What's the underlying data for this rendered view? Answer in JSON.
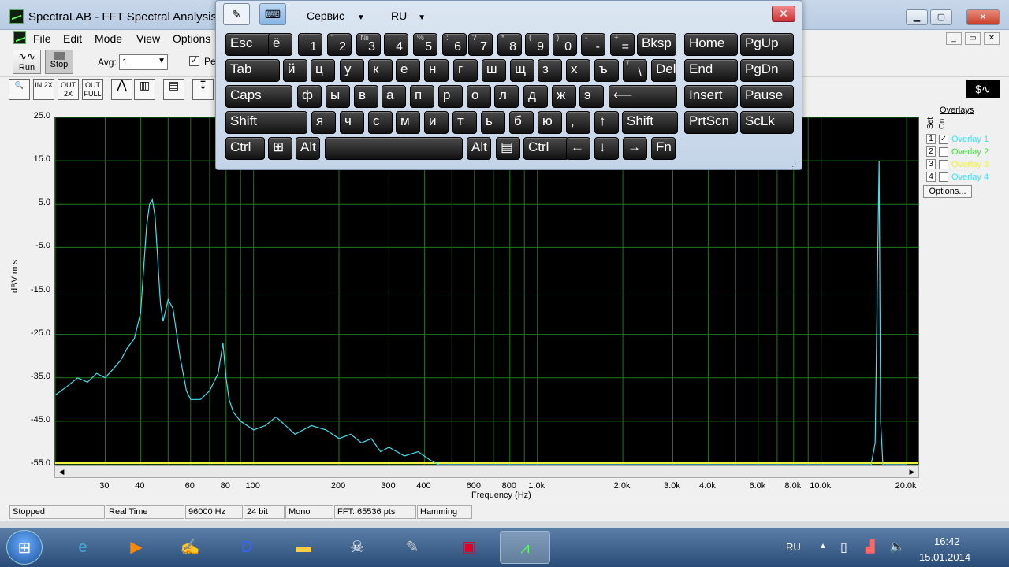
{
  "window": {
    "title": "SpectraLAB - FFT Spectral Analysis S"
  },
  "menu": [
    "File",
    "Edit",
    "Mode",
    "View",
    "Options"
  ],
  "toolbar": {
    "run_label": "Run",
    "stop_label": "Stop",
    "avg_label": "Avg:",
    "avg_value": "1",
    "pe_label": "Pe"
  },
  "toolbar2_icons": [
    "zoom-icon",
    "zoom-in-2x-icon",
    "zoom-out-2x-icon",
    "zoom-out-full-icon",
    "line-plot-icon",
    "bar-plot-icon",
    "table-icon",
    "cursor-icon"
  ],
  "toolbar2_labels": [
    "",
    "IN 2X",
    "OUT 2X",
    "OUT FULL",
    "",
    "",
    "",
    ""
  ],
  "osk": {
    "menu_service": "Сервис",
    "menu_lang": "RU",
    "rows": [
      [
        [
          "",
          "Esc"
        ],
        [
          "",
          "ё"
        ],
        [
          "!",
          "1"
        ],
        [
          "\"",
          "2"
        ],
        [
          "№",
          "3"
        ],
        [
          ";",
          "4"
        ],
        [
          "%",
          "5"
        ],
        [
          ":",
          "6"
        ],
        [
          "?",
          "7"
        ],
        [
          "*",
          "8"
        ],
        [
          "(",
          "9"
        ],
        [
          ")",
          "0"
        ],
        [
          "-",
          "-"
        ],
        [
          "+",
          "="
        ],
        [
          "",
          "Bksp"
        ],
        [
          "",
          "Home"
        ],
        [
          "",
          "PgUp"
        ]
      ],
      [
        [
          "",
          "Tab"
        ],
        [
          "",
          "й"
        ],
        [
          "",
          "ц"
        ],
        [
          "",
          "у"
        ],
        [
          "",
          "к"
        ],
        [
          "",
          "е"
        ],
        [
          "",
          "н"
        ],
        [
          "",
          "г"
        ],
        [
          "",
          "ш"
        ],
        [
          "",
          "щ"
        ],
        [
          "",
          "з"
        ],
        [
          "",
          "х"
        ],
        [
          "",
          "ъ"
        ],
        [
          "/",
          "\\"
        ],
        [
          "",
          "Del"
        ],
        [
          "",
          "End"
        ],
        [
          "",
          "PgDn"
        ]
      ],
      [
        [
          "",
          "Caps"
        ],
        [
          "",
          "ф"
        ],
        [
          "",
          "ы"
        ],
        [
          "",
          "в"
        ],
        [
          "",
          "а"
        ],
        [
          "",
          "п"
        ],
        [
          "",
          "р"
        ],
        [
          "",
          "о"
        ],
        [
          "",
          "л"
        ],
        [
          "",
          "д"
        ],
        [
          "",
          "ж"
        ],
        [
          "",
          "э"
        ],
        [
          "",
          "⟵"
        ],
        [
          "",
          "Insert"
        ],
        [
          "",
          "Pause"
        ]
      ],
      [
        [
          "",
          "Shift"
        ],
        [
          "",
          "я"
        ],
        [
          "",
          "ч"
        ],
        [
          "",
          "с"
        ],
        [
          "",
          "м"
        ],
        [
          "",
          "и"
        ],
        [
          "",
          "т"
        ],
        [
          "",
          "ь"
        ],
        [
          "",
          "б"
        ],
        [
          "",
          "ю"
        ],
        [
          "",
          ","
        ],
        [
          "",
          "↑"
        ],
        [
          "",
          "Shift"
        ],
        [
          "",
          "PrtScn"
        ],
        [
          "",
          "ScLk"
        ]
      ],
      [
        [
          "",
          "Ctrl"
        ],
        [
          "",
          "⊞"
        ],
        [
          "",
          "Alt"
        ],
        [
          "",
          ""
        ],
        [
          "",
          "Alt"
        ],
        [
          "",
          "▤"
        ],
        [
          "",
          "Ctrl"
        ],
        [
          "",
          "←"
        ],
        [
          "",
          "↓"
        ],
        [
          "",
          "→"
        ],
        [
          "",
          "Fn"
        ]
      ]
    ]
  },
  "chart_data": {
    "type": "line",
    "ylabel": "dBV rms",
    "xlabel": "Frequency (Hz)",
    "xscale": "log",
    "xlim": [
      20,
      22000
    ],
    "ylim": [
      -55,
      25
    ],
    "yticks": [
      "25.0",
      "15.0",
      "5.0",
      "-5.0",
      "-15.0",
      "-25.0",
      "-35.0",
      "-45.0",
      "-55.0"
    ],
    "xticks": [
      "30",
      "40",
      "60",
      "80",
      "100",
      "200",
      "300",
      "400",
      "600",
      "800",
      "1.0k",
      "2.0k",
      "3.0k",
      "4.0k",
      "6.0k",
      "8.0k",
      "10.0k",
      "20.0k"
    ],
    "grid": true,
    "series": [
      {
        "color": "#40e0f0",
        "x": [
          20,
          22,
          24,
          26,
          28,
          30,
          32,
          34,
          36,
          38,
          40,
          41,
          42,
          43,
          44,
          45,
          46,
          47,
          48,
          50,
          52,
          55,
          58,
          60,
          65,
          70,
          75,
          78,
          80,
          82,
          85,
          90,
          100,
          110,
          120,
          140,
          160,
          180,
          200,
          220,
          240,
          260,
          280,
          300,
          340,
          380,
          420,
          450,
          500,
          700,
          1000,
          2000,
          5000,
          10000,
          15000,
          15500,
          15800,
          16000,
          16200,
          16500,
          17000,
          20000
        ],
        "y": [
          -39,
          -37,
          -35,
          -36,
          -34,
          -35,
          -33,
          -31,
          -28,
          -26,
          -20,
          -10,
          0,
          5,
          6,
          2,
          -8,
          -18,
          -22,
          -17,
          -19,
          -30,
          -38,
          -40,
          -40,
          -38,
          -34,
          -27,
          -35,
          -40,
          -43,
          -45,
          -47,
          -46,
          -44,
          -48,
          -46,
          -47,
          -49,
          -48,
          -50,
          -49,
          -52,
          -51,
          -53,
          -52,
          -54,
          -55,
          -55,
          -55,
          -55,
          -55,
          -55,
          -55,
          -55,
          -50,
          -10,
          15,
          -45,
          -55,
          -55,
          -55
        ]
      }
    ]
  },
  "overlays": {
    "title": "Overlays",
    "set_label": "Set",
    "on_label": "On",
    "items": [
      {
        "num": "1",
        "label": "Overlay 1",
        "checked": true,
        "color": "#40e0f0"
      },
      {
        "num": "2",
        "label": "Overlay 2",
        "checked": false,
        "color": "#40e040"
      },
      {
        "num": "3",
        "label": "Overlay 3",
        "checked": false,
        "color": "#f0f040"
      },
      {
        "num": "4",
        "label": "Overlay 4",
        "checked": false,
        "color": "#40e0f0"
      }
    ],
    "options_label": "Options..."
  },
  "status": [
    "Stopped",
    "Real Time",
    "96000 Hz",
    "24 bit",
    "Mono",
    "FFT: 65536 pts",
    "Hamming"
  ],
  "tray": {
    "lang": "RU",
    "time": "16:42",
    "date": "15.01.2014"
  }
}
